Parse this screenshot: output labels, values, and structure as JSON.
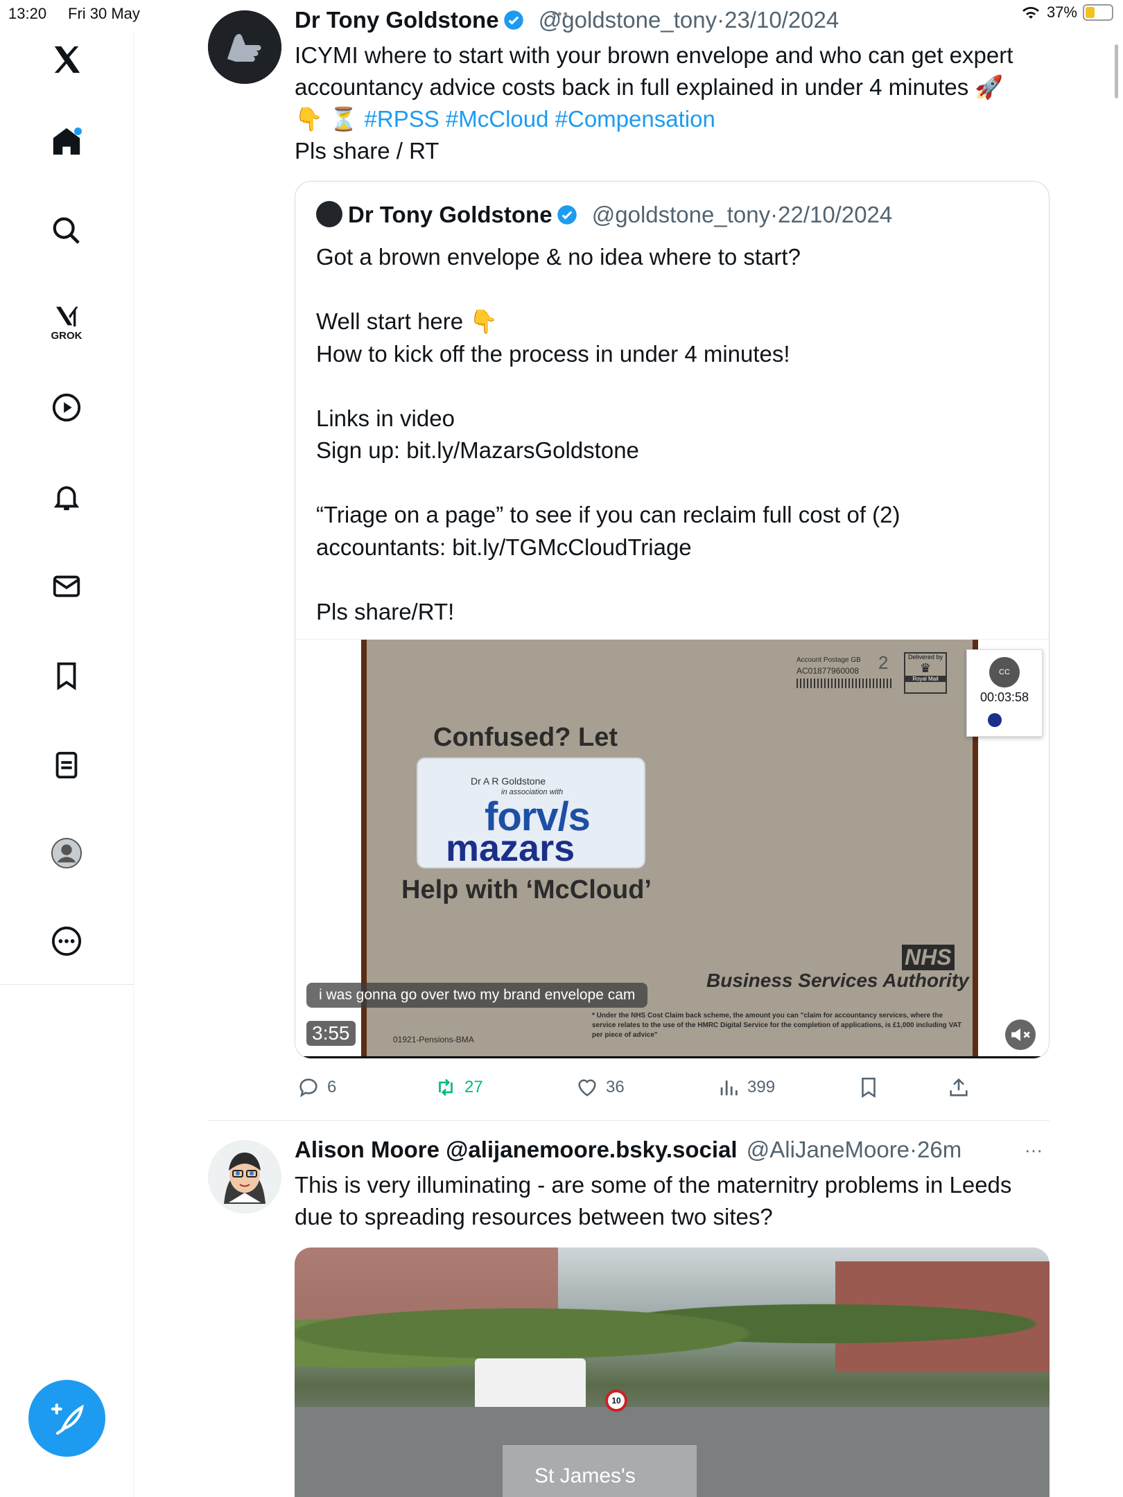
{
  "status_bar": {
    "time": "13:20",
    "date": "Fri 30 May",
    "battery": "37%",
    "battery_level": 0.37
  },
  "sidebar": {
    "items": [
      {
        "name": "x-logo-icon"
      },
      {
        "name": "home-icon"
      },
      {
        "name": "search-icon"
      },
      {
        "name": "grok-icon",
        "label": "GROK"
      },
      {
        "name": "video-icon"
      },
      {
        "name": "notifications-icon"
      },
      {
        "name": "messages-icon"
      },
      {
        "name": "bookmarks-icon"
      },
      {
        "name": "lists-icon"
      },
      {
        "name": "profile-icon"
      },
      {
        "name": "more-icon"
      }
    ],
    "compose_icon": "compose-feather-icon"
  },
  "tweet1": {
    "display_name": "Dr Tony Goldstone",
    "handle": "@goldstone_tony",
    "sep": "·",
    "date": "23/10/2024",
    "text_line1": "ICYMI where to start with your brown envelope and who can get expert",
    "text_line2": "accountancy advice costs back in full explained in under 4 minutes 🚀",
    "text_line3_emoji": "👇 ⏳",
    "hashtags": "#RPSS #McCloud #Compensation",
    "text_line4": "Pls share / RT",
    "quote": {
      "display_name": "Dr Tony Goldstone",
      "handle": "@goldstone_tony",
      "sep": "·",
      "date": "22/10/2024",
      "lines": [
        "Got a brown envelope & no idea where to start?",
        "",
        "Well start here 👇",
        "How to kick off the process in under 4 minutes!",
        "",
        "Links in video",
        "Sign up: bit.ly/MazarsGoldstone",
        "",
        "“Triage on a page” to see if you can reclaim full cost of (2)",
        "accountants: bit.ly/TGMcCloudTriage",
        "",
        "Pls share/RT!"
      ],
      "video": {
        "postage_label": "Account Postage GB",
        "postage_number": "AC01877960008",
        "class_number": "2",
        "delivered_by": "Delivered by",
        "royal_mail": "Royal Mail",
        "headline": "Confused? Let",
        "window_name": "Dr A R Goldstone",
        "window_sub": "in association with",
        "brand1": "forv/s",
        "brand2": "mazars",
        "help_text": "Help with ‘McCloud’",
        "nhs": "NHS",
        "bsa": "Business Services Authority",
        "footnote": "* Under the NHS Cost Claim back scheme, the amount you can \"claim for accountancy services, where the service relates to the use of the HMRC Digital Service for the completion of applications, is £1,000 including VAT per piece of advice\"",
        "ref": "01921-Pensions-BMA",
        "caption": "i was gonna go over two my brand envelope cam",
        "duration": "3:55",
        "mini_time": "00:03:58",
        "mini_cc": "CC"
      }
    },
    "actions": {
      "replies": "6",
      "reposts": "27",
      "likes": "36",
      "views": "399"
    }
  },
  "tweet2": {
    "display_name": "Alison Moore @alijanemoore.bsky.social",
    "handle": "@AliJaneMoore",
    "sep": "·",
    "time": "26m",
    "more": "···",
    "text_line1": "This is very illuminating - are some of the maternitry problems in Leeds",
    "text_line2": "due to spreading resources between two sites?",
    "photo_sign": "St James's"
  },
  "colors": {
    "accent": "#1d9bf0",
    "text": "#0f1419",
    "muted": "#536471",
    "repost": "#00ba7c"
  }
}
